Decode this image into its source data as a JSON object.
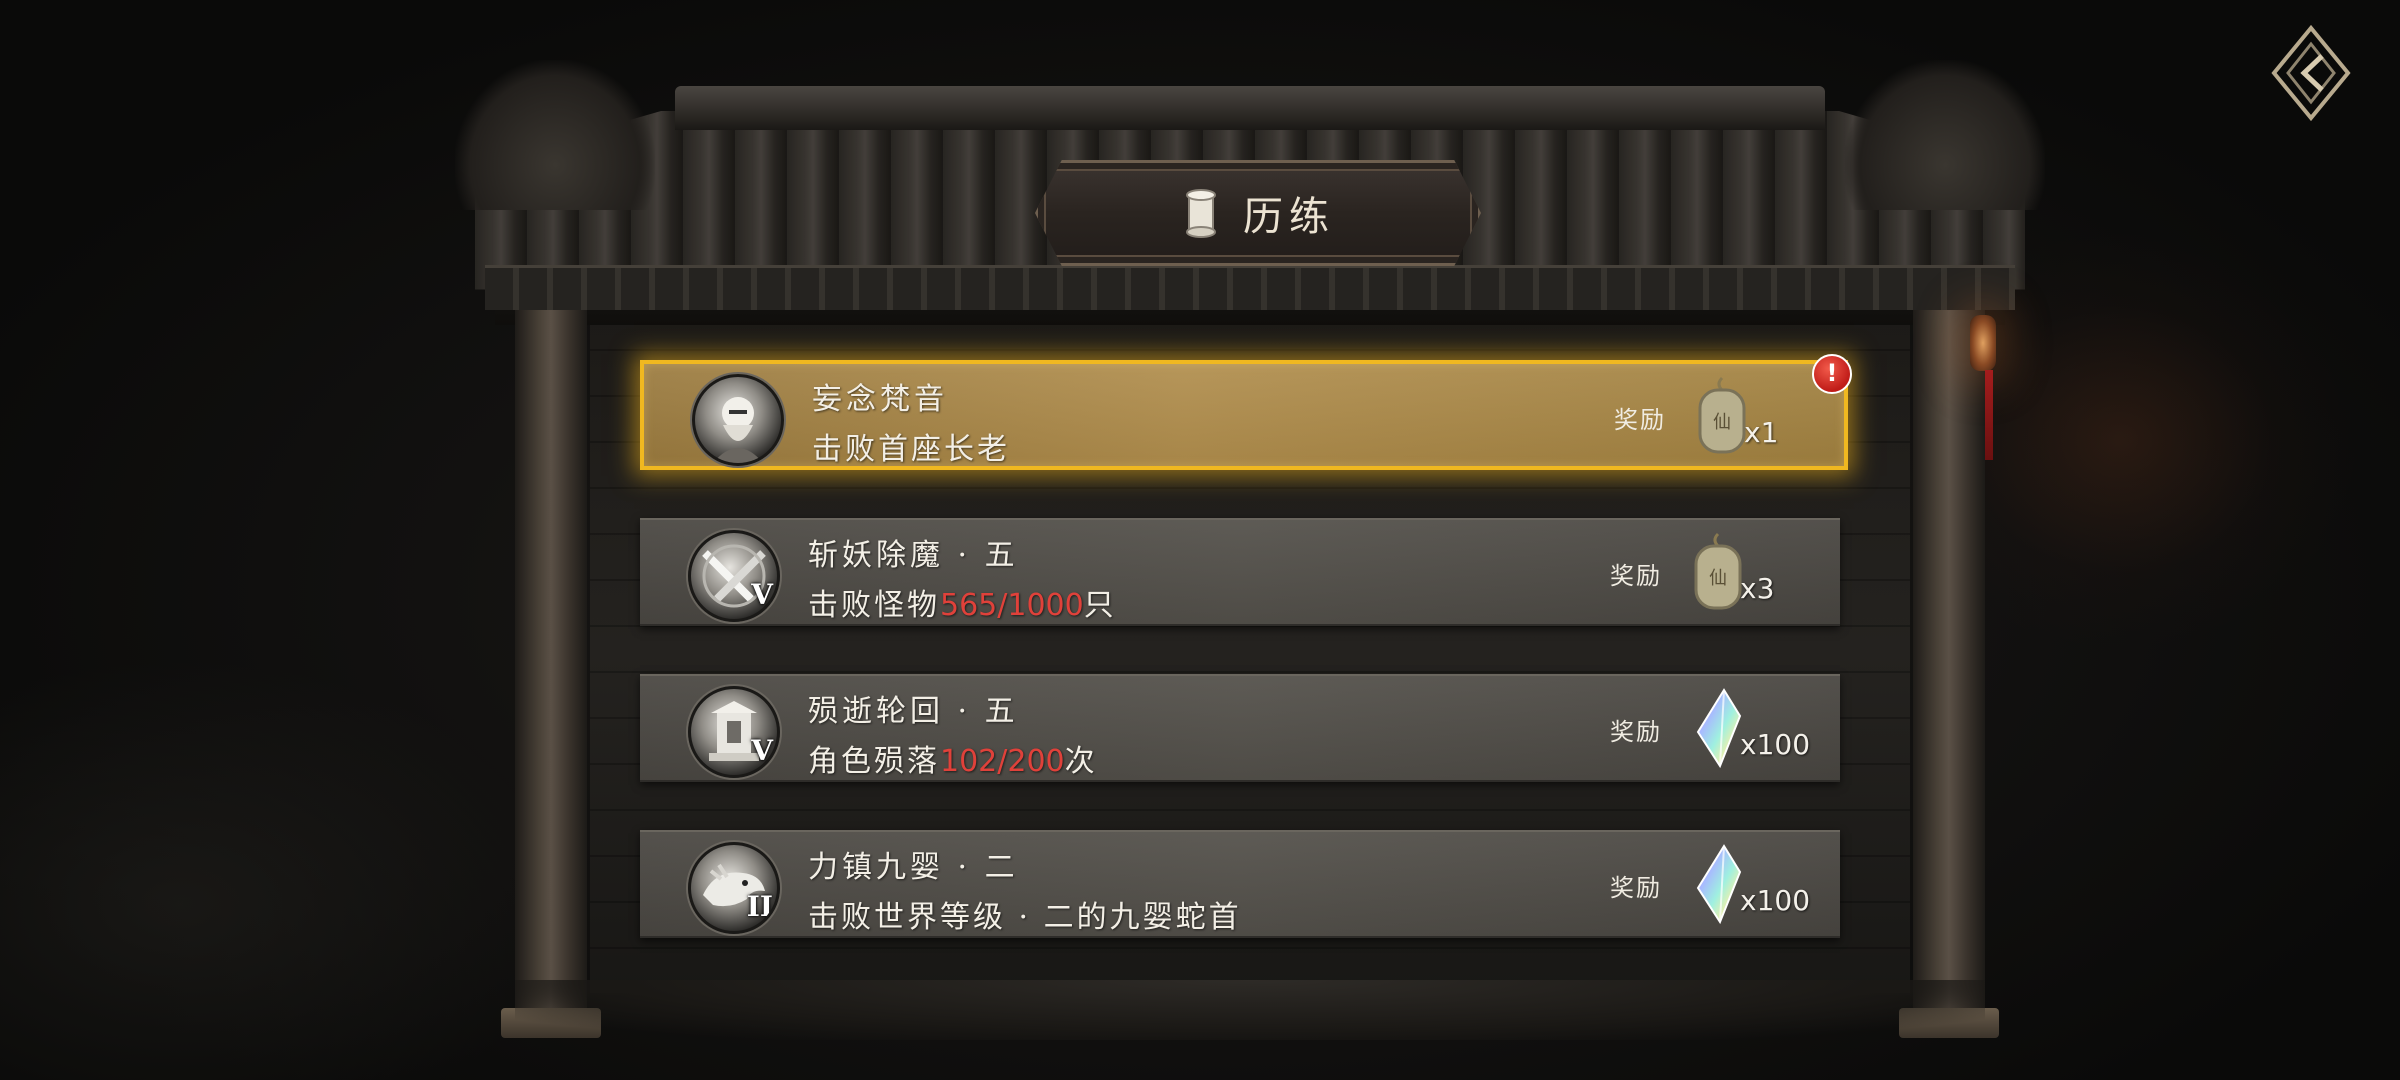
{
  "header": {
    "title": "历练"
  },
  "back_button": {
    "icon": "diamond-arrow-back-icon"
  },
  "quests": [
    {
      "name": "妄念梵音",
      "desc_prefix": "击败首座长老",
      "progress": "",
      "desc_suffix": "",
      "tier": "",
      "reward_label": "奖励",
      "reward_icon": "jade-token-icon",
      "reward_qty": "x1",
      "active": true,
      "alert": "!"
    },
    {
      "name": "斩妖除魔 · 五",
      "desc_prefix": "击败怪物",
      "progress": "565/1000",
      "desc_suffix": "只",
      "tier": "V",
      "reward_label": "奖励",
      "reward_icon": "jade-token-icon",
      "reward_qty": "x3",
      "active": false
    },
    {
      "name": "殒逝轮回 · 五",
      "desc_prefix": "角色殒落",
      "progress": "102/200",
      "desc_suffix": "次",
      "tier": "V",
      "reward_label": "奖励",
      "reward_icon": "rainbow-crystal-icon",
      "reward_qty": "x100",
      "active": false
    },
    {
      "name": "力镇九婴 · 二",
      "desc_prefix": "击败世界等级 · 二的九婴蛇首",
      "progress": "",
      "desc_suffix": "",
      "tier": "II",
      "reward_label": "奖励",
      "reward_icon": "rainbow-crystal-icon",
      "reward_qty": "x100",
      "active": false
    }
  ],
  "colors": {
    "highlight_border": "#f0b820",
    "progress_text": "#e0413a",
    "alert": "#c01c18"
  }
}
